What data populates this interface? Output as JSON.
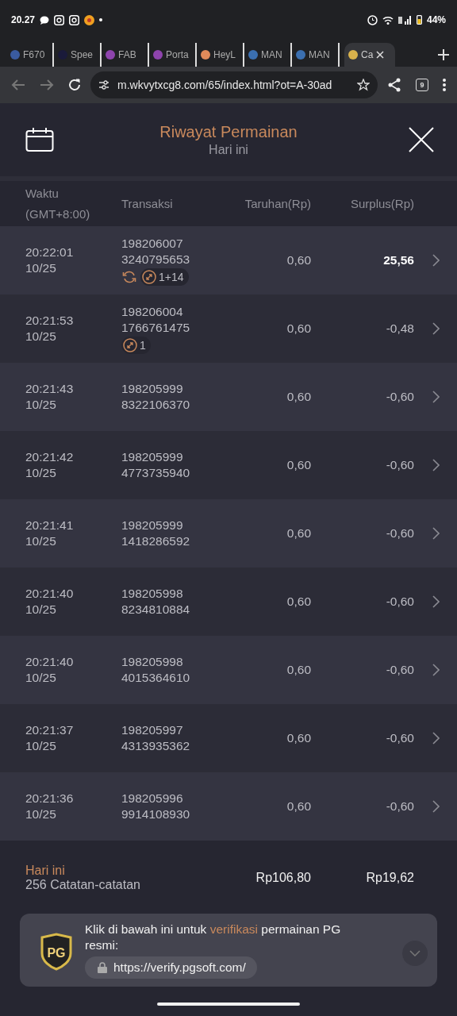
{
  "status_bar": {
    "time": "20.27",
    "battery": "44%"
  },
  "browser_tabs": [
    {
      "label": "F670",
      "selected": false
    },
    {
      "label": "Spee",
      "selected": false
    },
    {
      "label": "FAB",
      "selected": false
    },
    {
      "label": "Porta",
      "selected": false
    },
    {
      "label": "HeyL",
      "selected": false
    },
    {
      "label": "MAN",
      "selected": false
    },
    {
      "label": "MAN",
      "selected": false
    },
    {
      "label": "Ca",
      "selected": true
    }
  ],
  "address_bar": {
    "url": "m.wkvytxcg8.com/65/index.html?ot=A-30ad",
    "tab_count": "9"
  },
  "header": {
    "title": "Riwayat Permainan",
    "subtitle": "Hari ini"
  },
  "table": {
    "columns": [
      "Waktu (GMT+8:00)",
      "Transaksi",
      "Taruhan(Rp)",
      "Surplus(Rp)"
    ],
    "rows": [
      {
        "time": "20:22:01",
        "date": "10/25",
        "id_1": "198206007",
        "id_2": "3240795653",
        "tags": [
          {
            "kind": "respin"
          },
          {
            "kind": "free",
            "label": "1+14"
          }
        ],
        "bet": "0,60",
        "surplus": "25,56",
        "win": true
      },
      {
        "time": "20:21:53",
        "date": "10/25",
        "id_1": "198206004",
        "id_2": "1766761475",
        "tags": [
          {
            "kind": "free",
            "label": "1"
          }
        ],
        "bet": "0,60",
        "surplus": "-0,48",
        "win": false
      },
      {
        "time": "20:21:43",
        "date": "10/25",
        "id_1": "198205999",
        "id_2": "8322106370",
        "bet": "0,60",
        "surplus": "-0,60",
        "win": false
      },
      {
        "time": "20:21:42",
        "date": "10/25",
        "id_1": "198205999",
        "id_2": "4773735940",
        "bet": "0,60",
        "surplus": "-0,60",
        "win": false
      },
      {
        "time": "20:21:41",
        "date": "10/25",
        "id_1": "198205999",
        "id_2": "1418286592",
        "bet": "0,60",
        "surplus": "-0,60",
        "win": false
      },
      {
        "time": "20:21:40",
        "date": "10/25",
        "id_1": "198205998",
        "id_2": "8234810884",
        "bet": "0,60",
        "surplus": "-0,60",
        "win": false
      },
      {
        "time": "20:21:40",
        "date": "10/25",
        "id_1": "198205998",
        "id_2": "4015364610",
        "bet": "0,60",
        "surplus": "-0,60",
        "win": false
      },
      {
        "time": "20:21:37",
        "date": "10/25",
        "id_1": "198205997",
        "id_2": "4313935362",
        "bet": "0,60",
        "surplus": "-0,60",
        "win": false
      },
      {
        "time": "20:21:36",
        "date": "10/25",
        "id_1": "198205996",
        "id_2": "9914108930",
        "bet": "0,60",
        "surplus": "-0,60",
        "win": false
      }
    ]
  },
  "summary": {
    "period": "Hari ini",
    "records": "256 Catatan-catatan",
    "total_bet": "Rp106,80",
    "total_surplus": "Rp19,62"
  },
  "verify_banner": {
    "logo": "PG",
    "text_before": "Klik di bawah ini untuk ",
    "link": "verifikasi",
    "text_after": " permainan PG resmi:",
    "url": "https://verify.pgsoft.com/"
  }
}
